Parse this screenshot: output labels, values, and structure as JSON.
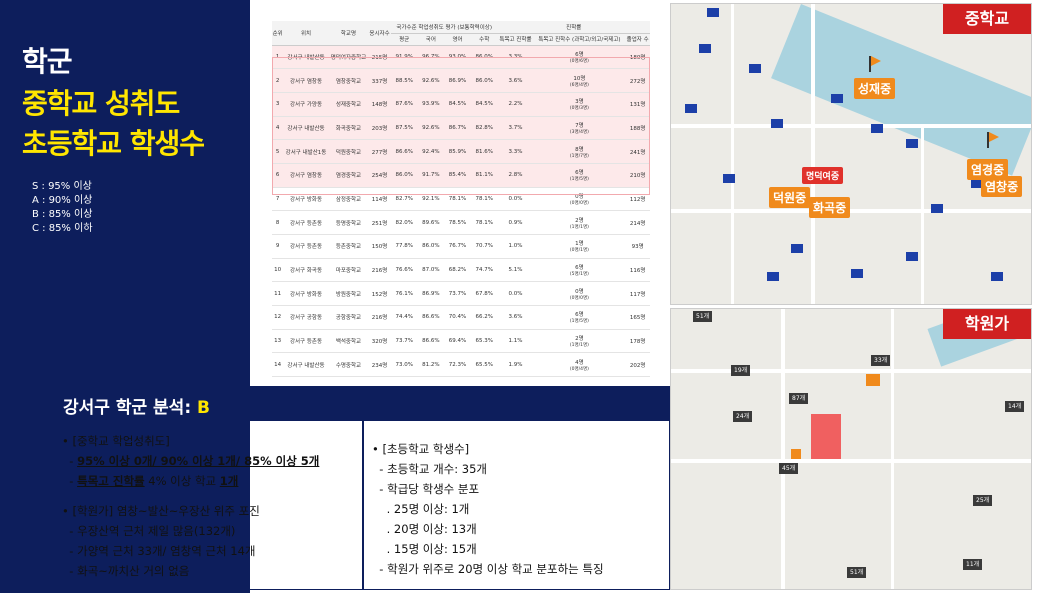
{
  "title": {
    "line1": "학군",
    "line2": "중학교 성취도",
    "line3": "초등학교 학생수"
  },
  "legend": [
    "S : 95% 이상",
    "A : 90% 이상",
    "B : 85% 이상",
    "C : 85% 이하"
  ],
  "table": {
    "group_headers": {
      "eval": "국가수준 학업성취도 평가 (보통학력이상)",
      "progress": "진학률"
    },
    "headers": [
      "순위",
      "위치",
      "학교명",
      "응시자수",
      "평균",
      "국어",
      "영어",
      "수학",
      "특목고 진학률",
      "특목고 진학수 (과학고/외고/국제고)",
      "졸업자 수"
    ],
    "rows": [
      [
        "1",
        "강서구 내발산동",
        "명덕여자중학교",
        "215명",
        "91.9%",
        "96.7%",
        "93.0%",
        "86.0%",
        "3.3%",
        "6명",
        "(0명/6명)",
        "180명"
      ],
      [
        "2",
        "강서구 염창동",
        "염창중학교",
        "337명",
        "88.5%",
        "92.6%",
        "86.9%",
        "86.0%",
        "3.6%",
        "10명",
        "(6명/4명)",
        "272명"
      ],
      [
        "3",
        "강서구 가양동",
        "성재중학교",
        "148명",
        "87.6%",
        "93.9%",
        "84.5%",
        "84.5%",
        "2.2%",
        "3명",
        "(0명/3명)",
        "131명"
      ],
      [
        "4",
        "강서구 내발산동",
        "화곡중학교",
        "203명",
        "87.5%",
        "92.6%",
        "86.7%",
        "82.8%",
        "3.7%",
        "7명",
        "(3명/4명)",
        "188명"
      ],
      [
        "5",
        "강서구 내발산1동",
        "덕원중학교",
        "277명",
        "86.6%",
        "92.4%",
        "85.9%",
        "81.6%",
        "3.3%",
        "8명",
        "(1명/7명)",
        "241명"
      ],
      [
        "6",
        "강서구 염창동",
        "염경중학교",
        "254명",
        "86.0%",
        "91.7%",
        "85.4%",
        "81.1%",
        "2.8%",
        "6명",
        "(1명/5명)",
        "210명"
      ],
      [
        "7",
        "강서구 방화동",
        "삼정중학교",
        "114명",
        "82.7%",
        "92.1%",
        "78.1%",
        "78.1%",
        "0.0%",
        "0명",
        "(0명/0명)",
        "112명"
      ],
      [
        "8",
        "강서구 등촌동",
        "등명중학교",
        "251명",
        "82.0%",
        "89.6%",
        "78.5%",
        "78.1%",
        "0.9%",
        "2명",
        "(1명/1명)",
        "214명"
      ],
      [
        "9",
        "강서구 등촌동",
        "등촌중학교",
        "150명",
        "77.8%",
        "86.0%",
        "76.7%",
        "70.7%",
        "1.0%",
        "1명",
        "(0명/1명)",
        "93명"
      ],
      [
        "10",
        "강서구 화곡동",
        "마포중학교",
        "216명",
        "76.6%",
        "87.0%",
        "68.2%",
        "74.7%",
        "5.1%",
        "6명",
        "(5명/1명)",
        "116명"
      ],
      [
        "11",
        "강서구 방화동",
        "방원중학교",
        "152명",
        "76.1%",
        "86.9%",
        "73.7%",
        "67.8%",
        "0.0%",
        "0명",
        "(0명/0명)",
        "117명"
      ],
      [
        "12",
        "강서구 공항동",
        "공항중학교",
        "216명",
        "74.4%",
        "86.6%",
        "70.4%",
        "66.2%",
        "3.6%",
        "6명",
        "(1명/5명)",
        "165명"
      ],
      [
        "13",
        "강서구 등촌동",
        "백석중학교",
        "320명",
        "73.7%",
        "86.6%",
        "69.4%",
        "65.3%",
        "1.1%",
        "2명",
        "(1명/1명)",
        "178명"
      ],
      [
        "14",
        "강서구 내발산동",
        "수명중학교",
        "234명",
        "73.0%",
        "81.2%",
        "72.3%",
        "65.5%",
        "1.9%",
        "4명",
        "(0명/4명)",
        "202명"
      ]
    ]
  },
  "map_top": {
    "tag": "중학교",
    "labels": [
      "성재중",
      "명덕여중",
      "덕원중",
      "화곡중",
      "염경중",
      "염창중"
    ]
  },
  "map_bottom": {
    "tag": "학원가",
    "labels": [
      "51개",
      "33개",
      "19개",
      "87개",
      "24개",
      "45개",
      "14개",
      "25개",
      "51개",
      "11개"
    ]
  },
  "analysis": {
    "title": "강서구 학군 분석: ",
    "grade": "B",
    "left": {
      "h1": "[중학교 학업성취도]",
      "l1": "95% 이상 0개/ 90% 이상 1개/ 85% 이상 5개",
      "l2a": "특목고 진학률",
      "l2b": " 4% 이상 학교 ",
      "l2c": "1개",
      "h2": "[학원가] 염창~발산~우장산 위주 포진",
      "l3": "우장산역 근처 제일 많음(132개)",
      "l4": "가양역 근처 33개/ 염창역 근처 14개",
      "l5": "화곡~까치산 거의 없음"
    },
    "right": {
      "h1": "[초등학교 학생수]",
      "l1": "초등학교 개수: 35개",
      "l2": "학급당 학생수 분포",
      "l3": ". 25명 이상: 1개",
      "l4": ". 20명 이상: 13개",
      "l5": ". 15명 이상: 15개",
      "l6": "학원가 위주로 20명 이상 학교 분포하는 특징"
    }
  }
}
